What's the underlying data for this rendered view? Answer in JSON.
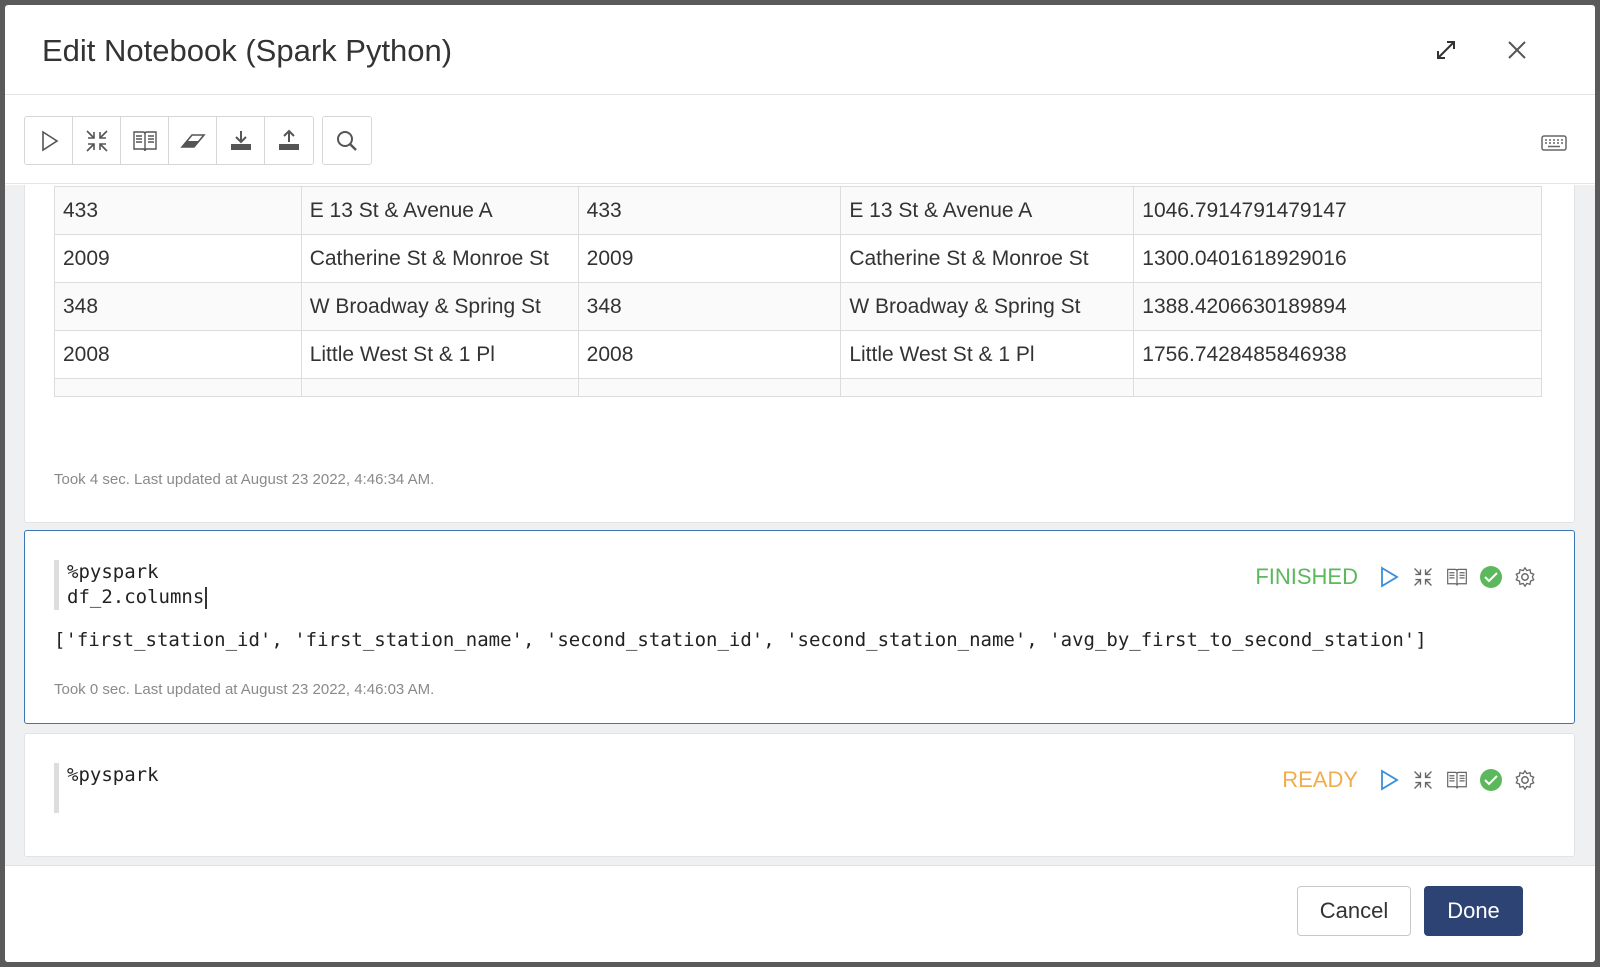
{
  "modal": {
    "title": "Edit Notebook (Spark Python)"
  },
  "toolbar": {
    "buttons": [
      "run-all",
      "collapse-all",
      "show-code",
      "clear-output",
      "export",
      "import",
      "search"
    ],
    "keyboard_icon": "keyboard-icon"
  },
  "paragraph1": {
    "rows": [
      [
        "433",
        "E 13 St & Avenue A",
        "433",
        "E 13 St & Avenue A",
        "1046.7914791479147"
      ],
      [
        "2009",
        "Catherine St & Monroe St",
        "2009",
        "Catherine St & Monroe St",
        "1300.0401618929016"
      ],
      [
        "348",
        "W Broadway & Spring St",
        "348",
        "W Broadway & Spring St",
        "1388.4206630189894"
      ],
      [
        "2008",
        "Little West St & 1 Pl",
        "2008",
        "Little West St & 1 Pl",
        "1756.7428485846938"
      ]
    ],
    "took": "Took 4 sec. Last updated at August 23 2022, 4:46:34 AM."
  },
  "paragraph2": {
    "code_line1": "%pyspark",
    "code_line2": "df_2.columns",
    "status": "FINISHED",
    "status_color": "#5cb85c",
    "output": "['first_station_id', 'first_station_name', 'second_station_id', 'second_station_name', 'avg_by_first_to_second_station']",
    "took": "Took 0 sec. Last updated at August 23 2022, 4:46:03 AM."
  },
  "paragraph3": {
    "code_line1": "%pyspark",
    "status": "READY",
    "status_color": "#f0ad4e"
  },
  "footer": {
    "cancel_label": "Cancel",
    "done_label": "Done"
  },
  "colors": {
    "accent": "#2d4373",
    "run_icon": "#3a8fd9",
    "check": "#5cb85c"
  }
}
